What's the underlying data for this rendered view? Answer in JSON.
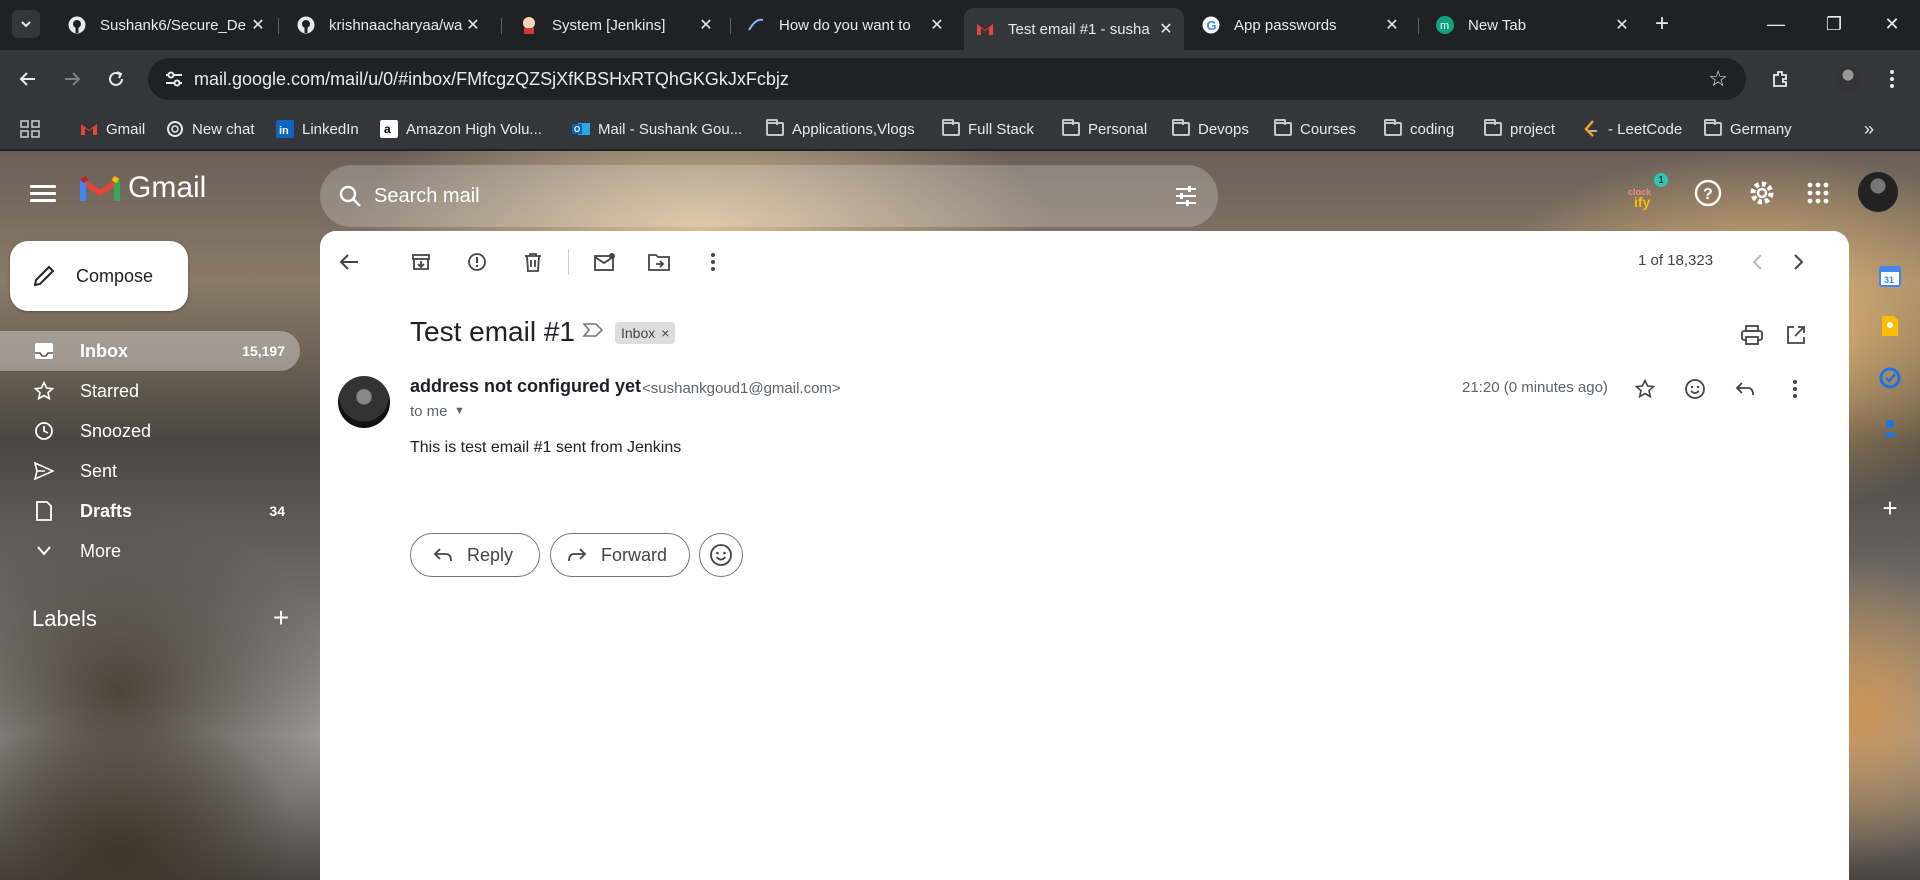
{
  "browser": {
    "tabs": [
      {
        "title": "Sushank6/Secure_De",
        "icon": "github-icon"
      },
      {
        "title": "krishnaacharyaa/wan",
        "icon": "github-icon"
      },
      {
        "title": "System [Jenkins]",
        "icon": "jenkins-icon"
      },
      {
        "title": "How do you want to",
        "icon": "perplexity-icon"
      },
      {
        "title": "Test email #1 - susha",
        "icon": "gmail-icon",
        "active": true
      },
      {
        "title": "App passwords",
        "icon": "google-icon"
      },
      {
        "title": "New Tab",
        "icon": "m-icon"
      }
    ],
    "url": "mail.google.com/mail/u/0/#inbox/FMfcgzQZSjXfKBSHxRTQhGKGkJxFcbjz",
    "bookmarks": [
      {
        "label": "Gmail",
        "icon": "gmail-icon"
      },
      {
        "label": "New chat",
        "icon": "chatgpt-icon"
      },
      {
        "label": "LinkedIn",
        "icon": "linkedin-icon"
      },
      {
        "label": "Amazon High Volu...",
        "icon": "amazon-icon"
      },
      {
        "label": "Mail - Sushank Gou...",
        "icon": "outlook-icon"
      },
      {
        "label": "Applications,Vlogs",
        "icon": "folder-icon"
      },
      {
        "label": "Full Stack",
        "icon": "folder-icon"
      },
      {
        "label": "Personal",
        "icon": "folder-icon"
      },
      {
        "label": "Devops",
        "icon": "folder-icon"
      },
      {
        "label": "Courses",
        "icon": "folder-icon"
      },
      {
        "label": "coding",
        "icon": "folder-icon"
      },
      {
        "label": "project",
        "icon": "folder-icon"
      },
      {
        "label": "- LeetCode",
        "icon": "leetcode-icon"
      },
      {
        "label": "Germany",
        "icon": "folder-icon"
      }
    ]
  },
  "gmail": {
    "brand": "Gmail",
    "search_placeholder": "Search mail",
    "compose_label": "Compose",
    "clock_badge": "1",
    "nav": [
      {
        "label": "Inbox",
        "count": "15,197",
        "icon": "inbox-icon",
        "active": true
      },
      {
        "label": "Starred",
        "count": "",
        "icon": "star-icon"
      },
      {
        "label": "Snoozed",
        "count": "",
        "icon": "clock-icon"
      },
      {
        "label": "Sent",
        "count": "",
        "icon": "send-icon"
      },
      {
        "label": "Drafts",
        "count": "34",
        "icon": "draft-icon"
      },
      {
        "label": "More",
        "count": "",
        "icon": "chevron-down-icon"
      }
    ],
    "labels_heading": "Labels",
    "pager": "1 of 18,323",
    "message": {
      "subject": "Test email #1",
      "chip": "Inbox",
      "sender_name": "address not configured yet",
      "sender_email": "<sushankgoud1@gmail.com>",
      "to": "to me",
      "time": "21:20 (0 minutes ago)",
      "body": "This is test email #1 sent from Jenkins"
    },
    "actions": {
      "reply": "Reply",
      "forward": "Forward"
    }
  },
  "colors": {
    "accent": "#1a73e8",
    "gmail_red": "#ea4335",
    "chrome_dark": "#202124"
  }
}
